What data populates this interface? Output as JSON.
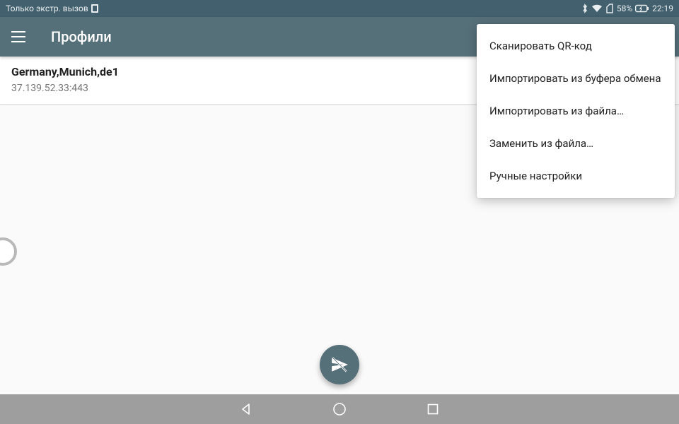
{
  "status": {
    "left_text": "Только экстр. вызов",
    "battery_pct": "58%",
    "time": "22:19"
  },
  "appbar": {
    "title": "Профили"
  },
  "profile": {
    "name": "Germany,Munich,de1",
    "address": "37.139.52.33:443"
  },
  "menu": {
    "items": [
      "Сканировать QR-код",
      "Импортировать из буфера обмена",
      "Импортировать из файла…",
      "Заменить из файла…",
      "Ручные настройки"
    ]
  }
}
